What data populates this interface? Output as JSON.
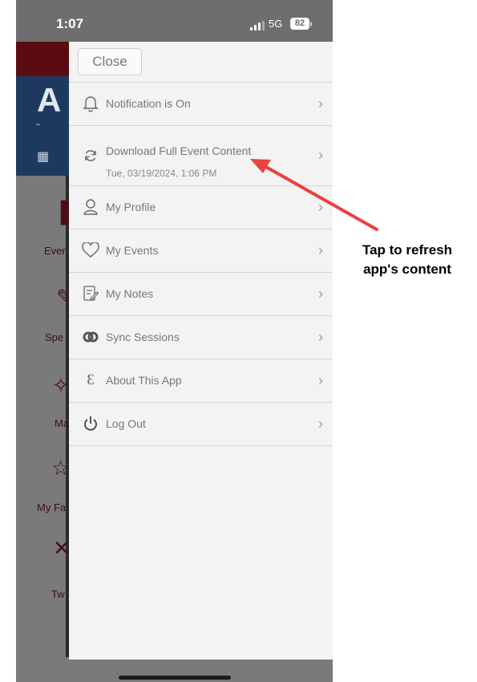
{
  "status_bar": {
    "time": "1:07",
    "network": "5G",
    "battery": "82"
  },
  "background_app": {
    "banner_letter": "A",
    "items": [
      "Ever",
      "Spe",
      "Ma",
      "My Fa",
      "Tw"
    ]
  },
  "drawer": {
    "close_label": "Close",
    "menu": [
      {
        "label": "Notification is On",
        "icon": "bell-icon"
      },
      {
        "label": "Download Full Event Content",
        "sublabel": "Tue, 03/19/2024, 1:06 PM",
        "icon": "refresh-icon"
      },
      {
        "label": "My Profile",
        "icon": "person-icon"
      },
      {
        "label": "My Events",
        "icon": "heart-icon"
      },
      {
        "label": "My Notes",
        "icon": "notes-icon"
      },
      {
        "label": "Sync Sessions",
        "icon": "sync-icon"
      },
      {
        "label": "About This App",
        "icon": "app-logo-icon"
      },
      {
        "label": "Log Out",
        "icon": "power-icon"
      }
    ]
  },
  "annotation": {
    "line1": "Tap to refresh",
    "line2": "app's content",
    "arrow_color": "#e8413f"
  }
}
